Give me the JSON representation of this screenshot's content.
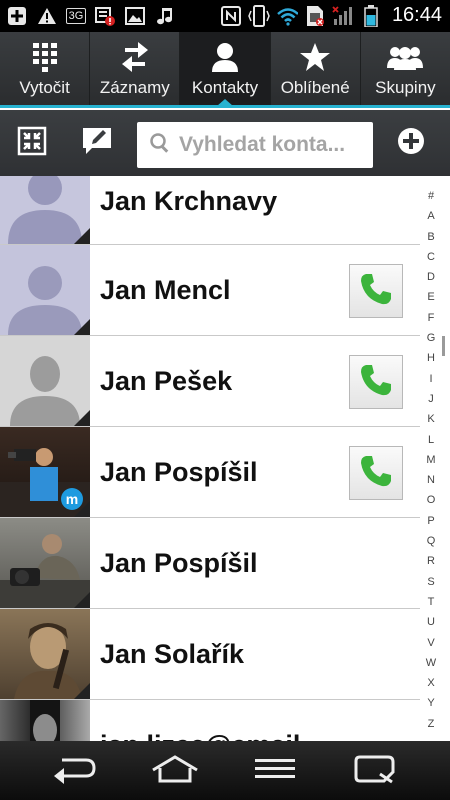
{
  "status_bar": {
    "time": "16:44",
    "network_badge": "3G",
    "icons": [
      "plus-icon",
      "warning-icon",
      "3g-icon",
      "notification-icon",
      "image-icon",
      "music-icon",
      "nfc-icon",
      "vibrate-icon",
      "wifi-icon",
      "sim-icon",
      "signal-icon",
      "battery-icon"
    ]
  },
  "tabs": [
    {
      "label": "Vytočit",
      "icon": "dialpad-icon",
      "active": false
    },
    {
      "label": "Záznamy",
      "icon": "arrows-icon",
      "active": false
    },
    {
      "label": "Kontakty",
      "icon": "person-icon",
      "active": true
    },
    {
      "label": "Oblíbené",
      "icon": "star-icon",
      "active": false
    },
    {
      "label": "Skupiny",
      "icon": "group-icon",
      "active": false
    }
  ],
  "toolbar": {
    "search_placeholder": "Vyhledat konta...",
    "icons": [
      "collapse-icon",
      "edit-icon",
      "search-icon",
      "add-icon"
    ]
  },
  "contacts": [
    {
      "name": "Jan Krchnavy",
      "avatar": "default",
      "call": false
    },
    {
      "name": "Jan Mencl",
      "avatar": "default",
      "call": true
    },
    {
      "name": "Jan Pešek",
      "avatar": "default-gray",
      "call": true
    },
    {
      "name": "Jan Pospíšil",
      "avatar": "photo-camera-blue",
      "call": true
    },
    {
      "name": "Jan Pospíšil",
      "avatar": "photo-camera-gray",
      "call": false
    },
    {
      "name": "Jan Solařík",
      "avatar": "photo-sepia",
      "call": false
    },
    {
      "name": "jan.lizec@email...",
      "avatar": "photo-bw",
      "call": false
    }
  ],
  "alphabet": [
    "#",
    "A",
    "B",
    "C",
    "D",
    "E",
    "F",
    "G",
    "H",
    "I",
    "J",
    "K",
    "L",
    "M",
    "N",
    "O",
    "P",
    "Q",
    "R",
    "S",
    "T",
    "U",
    "V",
    "W",
    "X",
    "Y",
    "Z"
  ],
  "navbar": {
    "icons": [
      "back-icon",
      "home-icon",
      "menu-icon",
      "qslide-icon"
    ]
  },
  "colors": {
    "accent": "#27b3d1",
    "tab_bg": "#333639",
    "active_tab_bg": "#1c1d1f",
    "call_green": "#3cb43c"
  }
}
